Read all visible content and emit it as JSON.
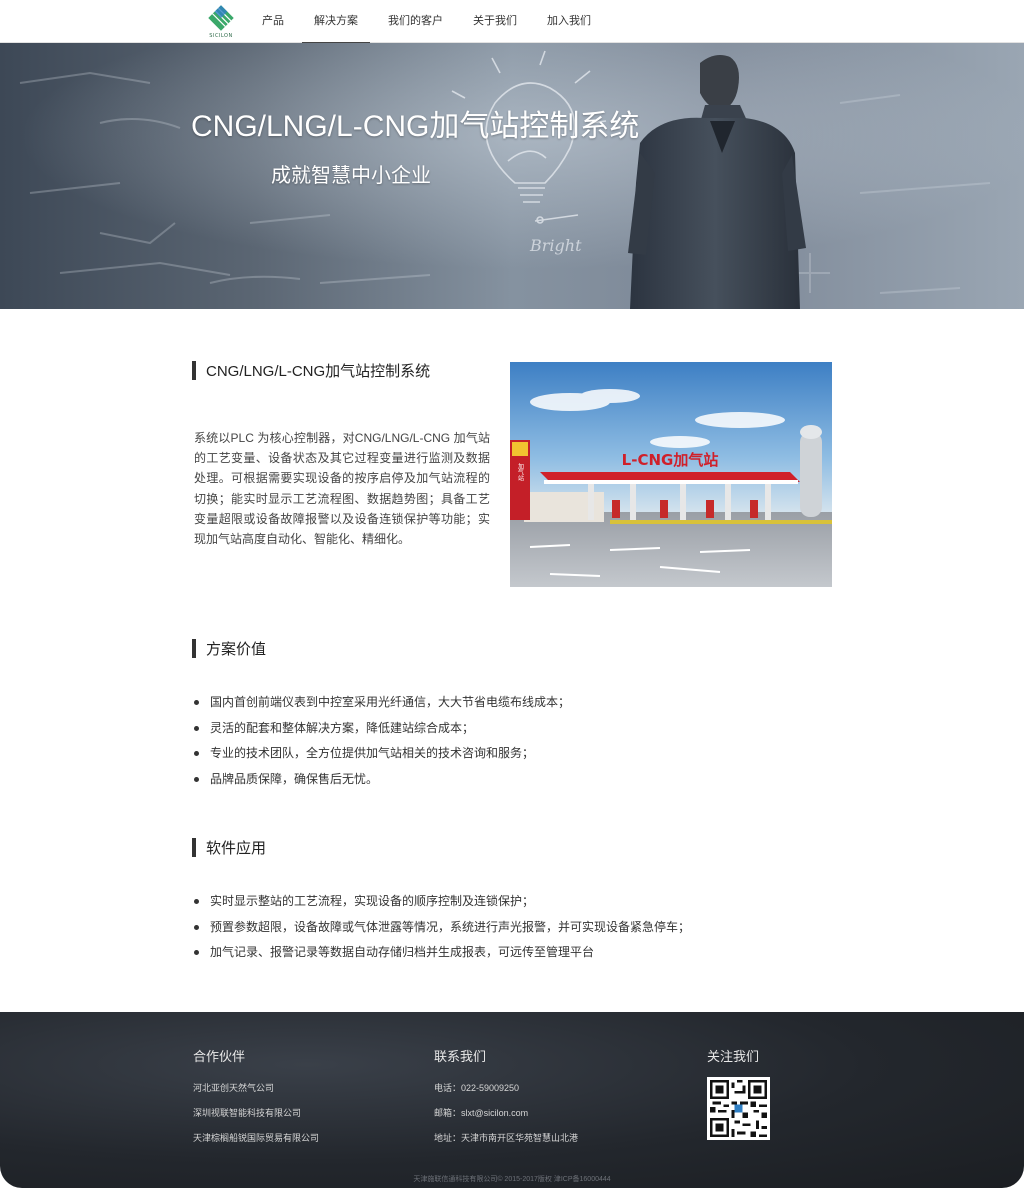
{
  "brand": {
    "logo_text": "SICILON"
  },
  "nav": {
    "items": [
      {
        "label": "产品"
      },
      {
        "label": "解决方案"
      },
      {
        "label": "我们的客户"
      },
      {
        "label": "关于我们"
      },
      {
        "label": "加入我们"
      }
    ],
    "active_index": 1
  },
  "banner": {
    "title": "CNG/LNG/L-CNG加气站控制系统",
    "subtitle": "成就智慧中小企业",
    "sketch_text": "Bright"
  },
  "intro": {
    "heading": "CNG/LNG/L-CNG加气站控制系统",
    "body": "系统以PLC 为核心控制器，对CNG/LNG/L-CNG 加气站的工艺变量、设备状态及其它过程变量进行监测及数据处理。可根据需要实现设备的按序启停及加气站流程的切换；能实时显示工艺流程图、数据趋势图；具备工艺变量超限或设备故障报警以及设备连锁保护等功能；实现加气站高度自动化、智能化、精细化。",
    "photo_sign": "L-CNG加气站",
    "photo_pole_text": "加气站"
  },
  "value": {
    "heading": "方案价值",
    "items": [
      "国内首创前端仪表到中控室采用光纤通信，大大节省电缆布线成本；",
      "灵活的配套和整体解决方案，降低建站综合成本；",
      "专业的技术团队，全方位提供加气站相关的技术咨询和服务；",
      "品牌品质保障，确保售后无忧。"
    ]
  },
  "software": {
    "heading": "软件应用",
    "items": [
      "实时显示整站的工艺流程，实现设备的顺序控制及连锁保护；",
      "预置参数超限，设备故障或气体泄露等情况，系统进行声光报警，并可实现设备紧急停车；",
      "加气记录、报警记录等数据自动存储归档并生成报表，可远传至管理平台"
    ]
  },
  "footer": {
    "partners": {
      "title": "合作伙伴",
      "items": [
        "河北亚创天然气公司",
        "深圳视联智能科技有限公司",
        "天津棕榈船锐国际贸易有限公司"
      ]
    },
    "contact": {
      "title": "联系我们",
      "phone": "电话：022-59009250",
      "email": "邮箱：slxt@sicilon.com",
      "address": "地址：天津市南开区华苑智慧山北港"
    },
    "follow": {
      "title": "关注我们"
    },
    "copyright": "天津施联信通科技有限公司© 2015-2017版权 津ICP备16000444"
  },
  "colors": {
    "accent": "#333333",
    "footer_bg": "#23272d",
    "sign_red": "#d0202a"
  }
}
